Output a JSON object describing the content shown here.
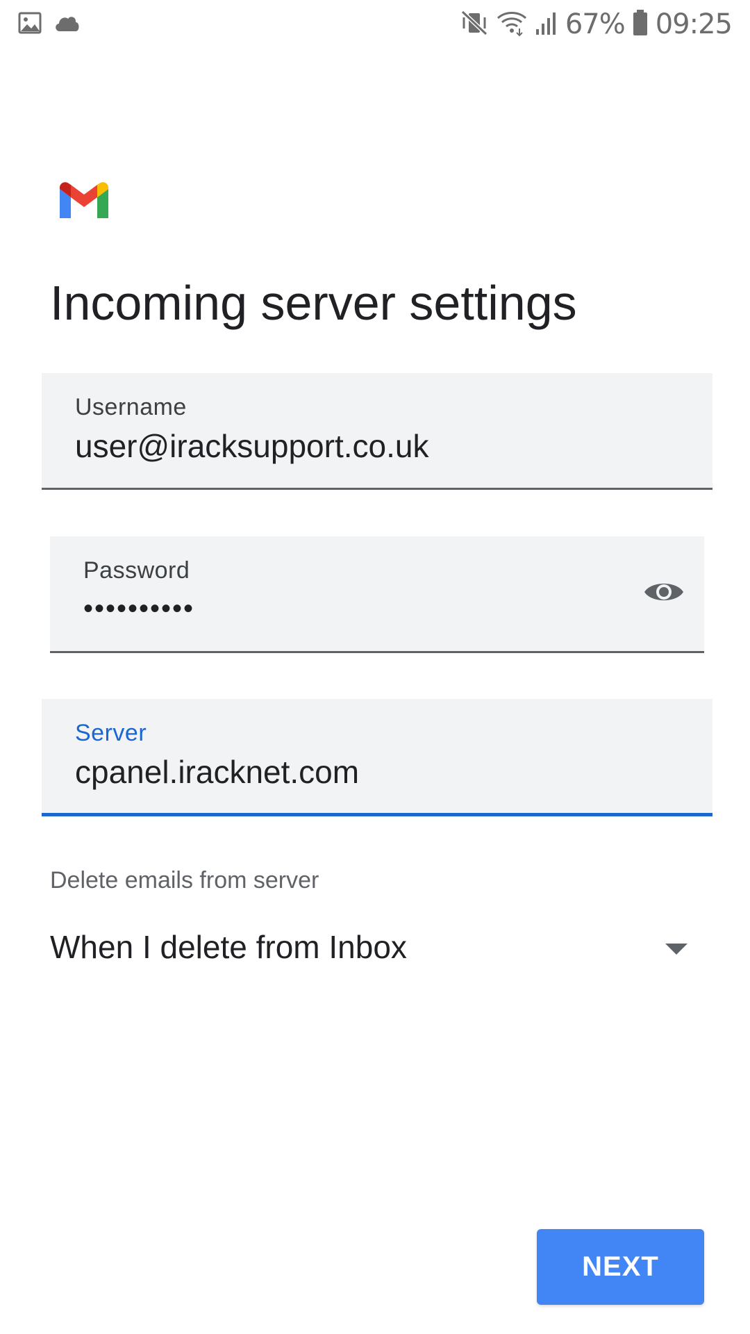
{
  "status_bar": {
    "left_icons": [
      "image-icon",
      "cloud-icon"
    ],
    "right_icons": [
      "vibrate-mute-icon",
      "wifi-icon",
      "signal-icon",
      "battery-icon"
    ],
    "battery": "67%",
    "time": "09:25"
  },
  "logo": {
    "name": "gmail-logo",
    "colors": {
      "blue": "#4285f4",
      "red": "#ea4335",
      "yellow": "#fbbc04",
      "green": "#34a853",
      "dark_red": "#c5221f"
    }
  },
  "page": {
    "title": "Incoming server settings"
  },
  "fields": {
    "username": {
      "label": "Username",
      "value": "user@iracksupport.co.uk"
    },
    "password": {
      "label": "Password",
      "value": "••••••••••",
      "icon": "eye-icon"
    },
    "server": {
      "label": "Server",
      "value": "cpanel.iracknet.com",
      "focused": true
    }
  },
  "delete_setting": {
    "label": "Delete emails from server",
    "selected": "When I delete from Inbox",
    "icon": "dropdown-arrow-icon"
  },
  "actions": {
    "next_label": "NEXT"
  },
  "colors": {
    "accent": "#1a66d2",
    "button": "#4285f4",
    "field_background": "#f1f3f4"
  }
}
